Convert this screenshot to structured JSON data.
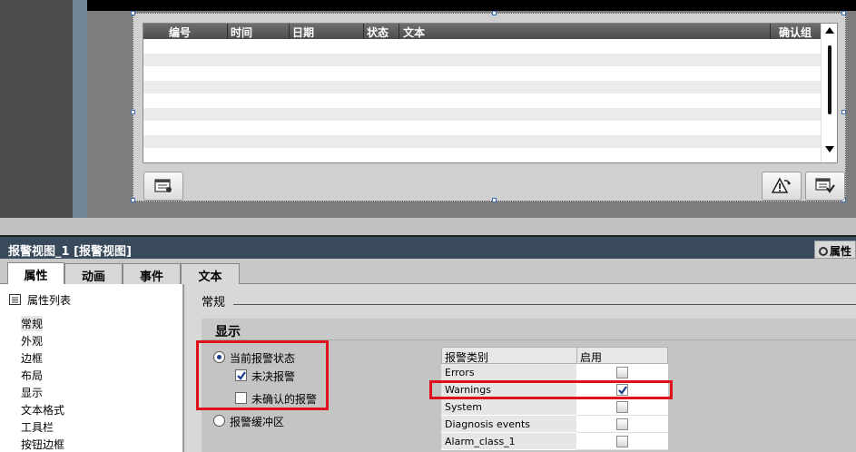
{
  "alarm_view": {
    "columns": [
      "编号",
      "时间",
      "日期",
      "状态",
      "文本",
      "确认组"
    ],
    "buttons": {
      "left_icon": "alarm-list-icon",
      "acknowledge_icon": "acknowledge-alarm-icon",
      "loop_icon": "loop-in-alarm-icon"
    }
  },
  "inspector": {
    "title": "报警视图_1 [报警视图]",
    "side_tab": "属性",
    "tabs": [
      {
        "label": "属性",
        "active": true
      },
      {
        "label": "动画",
        "active": false
      },
      {
        "label": "事件",
        "active": false
      },
      {
        "label": "文本",
        "active": false
      }
    ],
    "nav": {
      "list_title": "属性列表",
      "items": [
        "常规",
        "外观",
        "边框",
        "布局",
        "显示",
        "文本格式",
        "工具栏",
        "按钮边框"
      ],
      "selected": "常规"
    },
    "section": "常规",
    "display": {
      "title": "显示",
      "current_alarm_state": {
        "label": "当前报警状态",
        "selected": true
      },
      "pending_alarms": {
        "label": "未决报警",
        "checked": true
      },
      "unacknowledged_alarms": {
        "label": "未确认的报警",
        "checked": false
      },
      "alarm_buffer": {
        "label": "报警缓冲区",
        "selected": false
      }
    },
    "alarm_classes": {
      "header_name": "报警类别",
      "header_enabled": "启用",
      "rows": [
        {
          "name": "Errors",
          "enabled": false
        },
        {
          "name": "Warnings",
          "enabled": true
        },
        {
          "name": "System",
          "enabled": false
        },
        {
          "name": "Diagnosis events",
          "enabled": false
        },
        {
          "name": "Alarm_class_1",
          "enabled": false
        }
      ]
    }
  },
  "colors": {
    "highlight": "#e0101c",
    "titlebar": "#384a5c",
    "check": "#1b3f8f"
  }
}
